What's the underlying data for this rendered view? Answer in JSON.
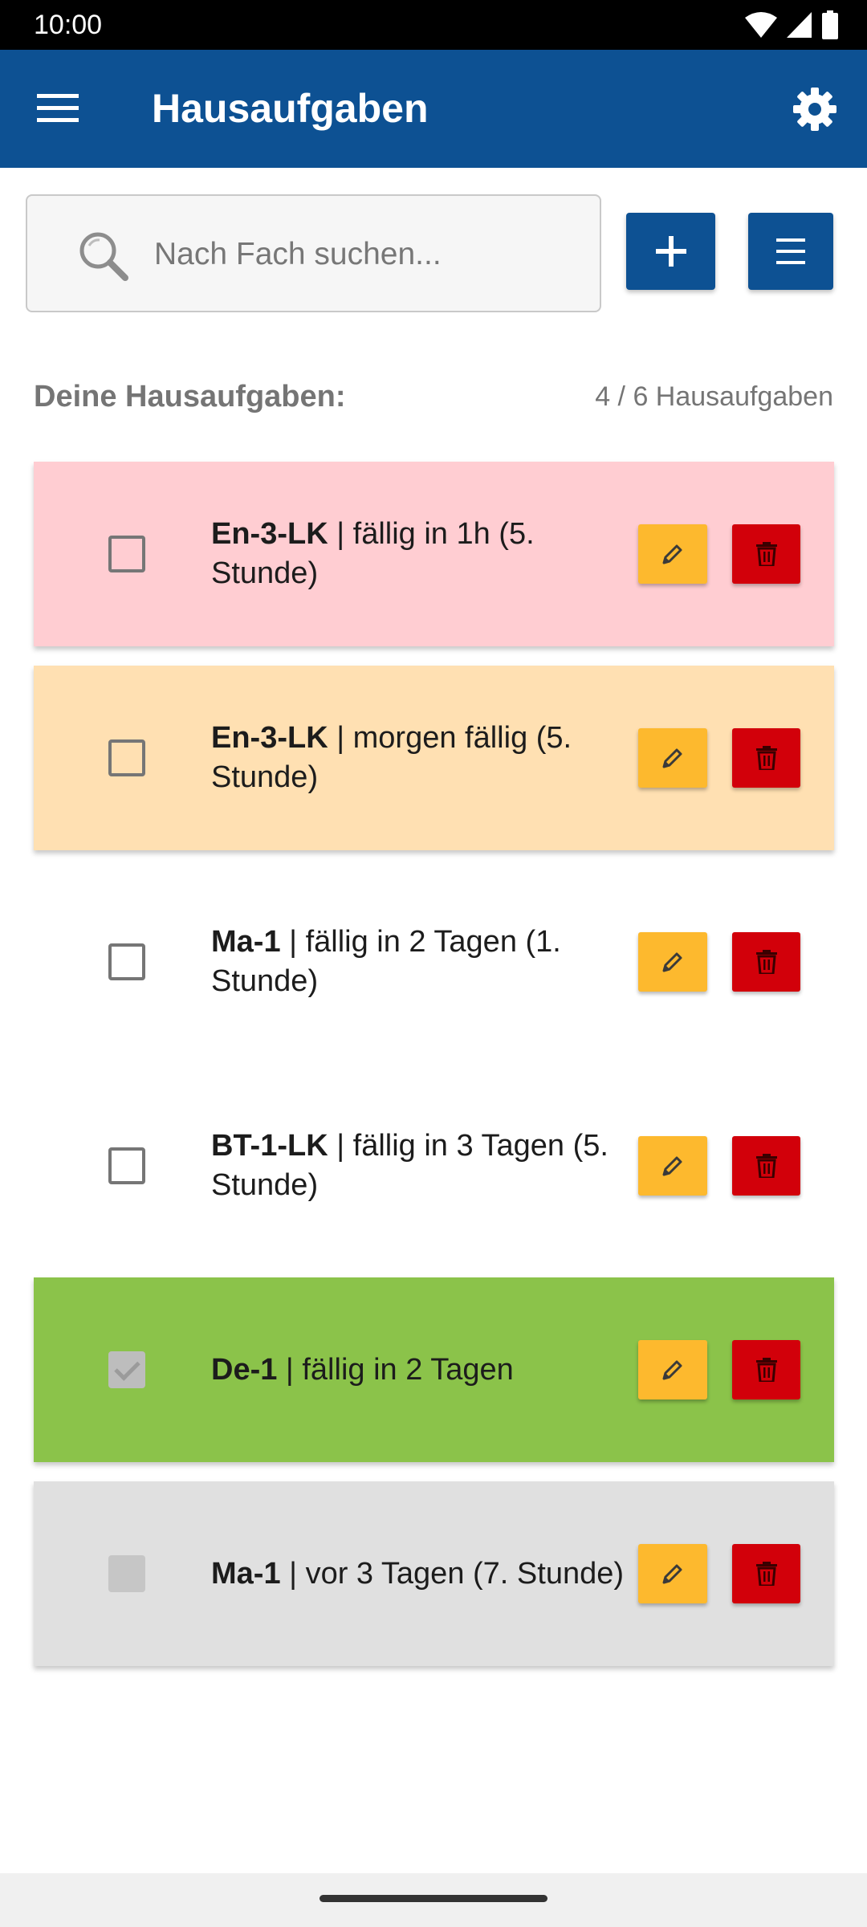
{
  "status_bar": {
    "time": "10:00"
  },
  "app_bar": {
    "title": "Hausaufgaben",
    "menu_icon": "hamburger-menu-icon",
    "settings_icon": "gear-icon"
  },
  "search": {
    "placeholder": "Nach Fach suchen...",
    "value": ""
  },
  "summary": {
    "title": "Deine Hausaufgaben:",
    "count": "4 / 6 Hausaufgaben"
  },
  "colors": {
    "primary": "#0d5193",
    "edit": "#fdb92e",
    "delete": "#d2000a",
    "overdue_today": "#ffcdd2",
    "due_tomorrow": "#ffe0b2",
    "done": "#8bc34a",
    "past": "#e0e0e0"
  },
  "homework": [
    {
      "subject": "En-3-LK",
      "detail": " | fällig in 1h (5. Stunde)",
      "bg": "#ffcdd2",
      "checked": false,
      "state": "open"
    },
    {
      "subject": "En-3-LK",
      "detail": " | morgen fällig (5. Stunde)",
      "bg": "#ffe0b2",
      "checked": false,
      "state": "open"
    },
    {
      "subject": "Ma-1",
      "detail": " | fällig in 2 Tagen (1. Stunde)",
      "bg": "#ffffff",
      "checked": false,
      "state": "open"
    },
    {
      "subject": "BT-1-LK",
      "detail": " | fällig in 3 Tagen (5. Stunde)",
      "bg": "#ffffff",
      "checked": false,
      "state": "open"
    },
    {
      "subject": "De-1",
      "detail": " | fällig in 2 Tagen",
      "bg": "#8bc34a",
      "checked": true,
      "state": "done"
    },
    {
      "subject": "Ma-1",
      "detail": " | vor 3 Tagen (7. Stunde)",
      "bg": "#e0e0e0",
      "checked": false,
      "state": "past"
    }
  ]
}
